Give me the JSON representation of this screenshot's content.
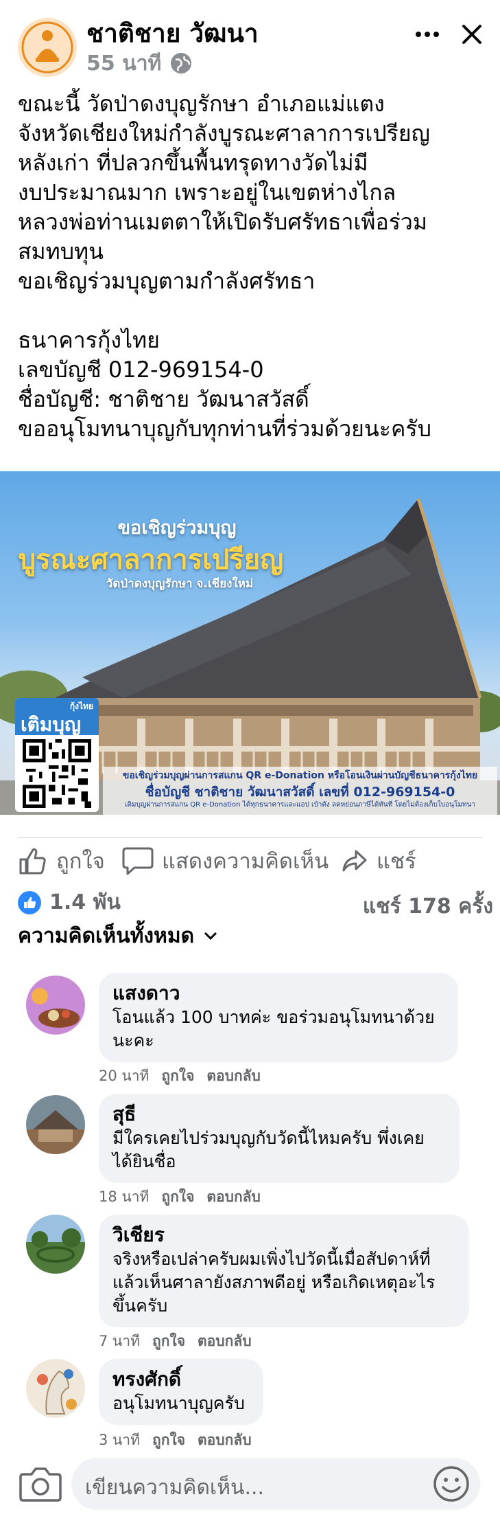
{
  "post": {
    "author": "ชาติชาย วัฒนา",
    "time": "55 นาที",
    "text": "ขณะนี้ วัดป่าดงบุญรักษา อำเภอแม่แตง\nจังหวัดเชียงใหม่กำลังบูรณะศาลาการเปรียญ\nหลังเก่า ที่ปลวกขึ้นพื้นทรุดทางวัดไม่มี\nงบประมาณมาก เพราะอยู่ในเขตห่างไกล\nหลวงพ่อท่านเมตตาให้เปิดรับศรัทธาเพื่อร่วม\nสมทบทุน\nขอเชิญร่วมบุญตามกำลังศรัทธา\n\nธนาคารกุ้งไทย\nเลขบัญชี 012-969154-0\nชื่อบัญชี: ชาติชาย วัฒนาสวัสดิ์\nขออนุโมทนาบุญกับทุกท่านที่ร่วมด้วยนะครับ"
  },
  "image": {
    "line1": "ขอเชิญร่วมบุญ",
    "line2": "บูรณะศาลาการเปรียญ",
    "line3": "วัดป่าดงบุญรักษา จ.เชียงใหม่",
    "qr_bank": "กุ้งไทย",
    "qr_brand": "เติมบุญ",
    "band1": "ขอเชิญร่วมบุญผ่านการสแกน QR e-Donation หรือโอนเงินผ่านบัญชีธนาคารกุ้งไทย",
    "band2": "ชื่อบัญชี ชาติชาย วัฒนาสวัสดิ์ เลขที่ 012-969154-0",
    "band3": "เติมบุญผ่านการสแกน QR e-Donation ได้ทุกธนาคารและแอป เป๋าตัง ลดหย่อนภาษีได้ทันที โดยไม่ต้องเก็บใบอนุโมทนา"
  },
  "actions": {
    "like": "ถูกใจ",
    "comment": "แสดงความคิดเห็น",
    "share": "แชร์"
  },
  "stats": {
    "likes": "1.4 พัน",
    "shares": "แชร์ 178 ครั้ง"
  },
  "comments_header": "ความคิดเห็นทั้งหมด",
  "comments": [
    {
      "name": "แสงดาว",
      "text": "โอนแล้ว 100 บาทค่ะ ขอร่วมอนุโมทนาด้วย\nนะคะ",
      "time": "20 นาที",
      "like": "ถูกใจ",
      "reply": "ตอบกลับ"
    },
    {
      "name": "สุธี",
      "text": "มีใครเคยไปร่วมบุญกับวัดนี้ไหมครับ พึ่งเคย\nได้ยินชื่อ",
      "time": "18 นาที",
      "like": "ถูกใจ",
      "reply": "ตอบกลับ"
    },
    {
      "name": "วิเชียร",
      "text": "จริงหรือเปล่าครับผมเพิ่งไปวัดนี้เมื่อสัปดาห์ที่\nแล้วเห็นศาลายังสภาพดีอยู่ หรือเกิดเหตุอะไร\nขึ้นครับ",
      "time": "7 นาที",
      "like": "ถูกใจ",
      "reply": "ตอบกลับ"
    },
    {
      "name": "ทรงศักดิ์",
      "text": "อนุโมทนาบุญครับ",
      "time": "3 นาที",
      "like": "ถูกใจ",
      "reply": "ตอบกลับ"
    }
  ],
  "composer": {
    "placeholder": "เขียนความคิดเห็น..."
  },
  "icons": {
    "more": "more-horizontal-icon",
    "close": "close-icon",
    "privacy": "globe-icon",
    "camera": "camera-icon",
    "emoji": "emoji-icon"
  },
  "colors": {
    "accent": "#2d88ff",
    "secondary_text": "#65676b",
    "bubble": "#f0f2f5"
  }
}
